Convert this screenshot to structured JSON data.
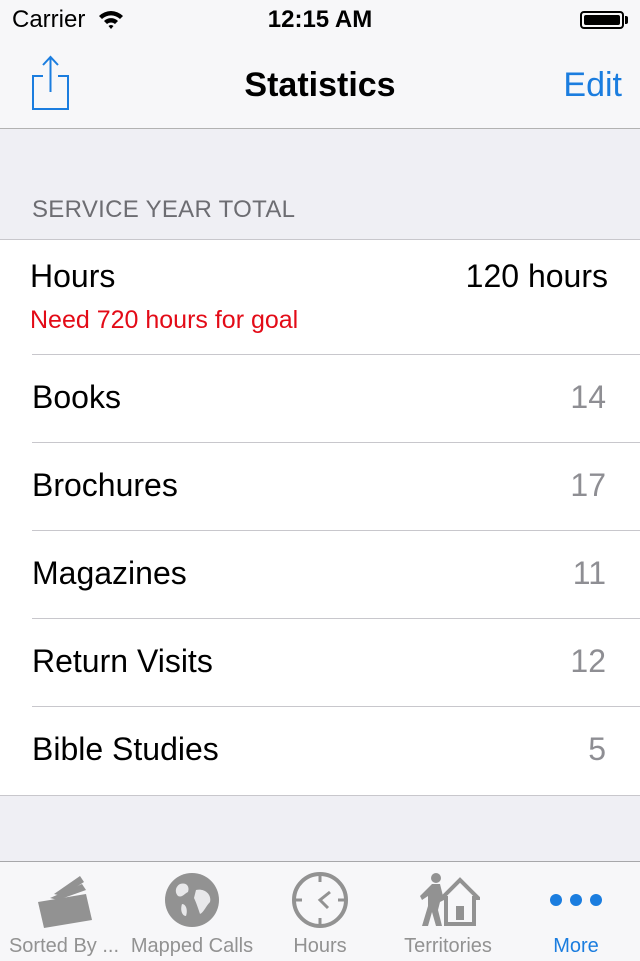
{
  "status_bar": {
    "carrier": "Carrier",
    "time": "12:15 AM",
    "wifi_icon": "wifi-icon",
    "battery_icon": "battery-full-icon"
  },
  "nav": {
    "title": "Statistics",
    "left_icon": "share-icon",
    "right_label": "Edit"
  },
  "section": {
    "header": "SERVICE YEAR TOTAL",
    "hours": {
      "label": "Hours",
      "value": "120 hours",
      "note": "Need 720 hours for goal"
    },
    "rows": [
      {
        "label": "Books",
        "value": "14"
      },
      {
        "label": "Brochures",
        "value": "17"
      },
      {
        "label": "Magazines",
        "value": "11"
      },
      {
        "label": "Return Visits",
        "value": "12"
      },
      {
        "label": "Bible Studies",
        "value": "5"
      }
    ]
  },
  "tabbar": {
    "items": [
      {
        "label": "Sorted By ...",
        "icon": "cards-icon",
        "active": false
      },
      {
        "label": "Mapped Calls",
        "icon": "globe-icon",
        "active": false
      },
      {
        "label": "Hours",
        "icon": "clock-icon",
        "active": false
      },
      {
        "label": "Territories",
        "icon": "territory-house-icon",
        "active": false
      },
      {
        "label": "More",
        "icon": "more-dots-icon",
        "active": true
      }
    ]
  },
  "colors": {
    "accent": "#1b7ddf",
    "warning": "#e30b17",
    "secondary_text": "#8e8e93",
    "inactive_tab": "#929292"
  }
}
